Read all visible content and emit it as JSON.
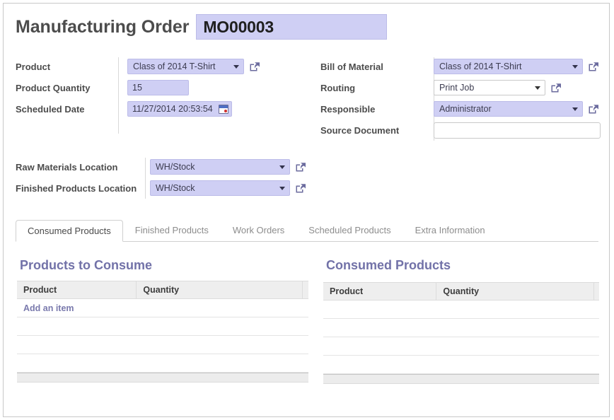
{
  "header": {
    "title": "Manufacturing Order",
    "reference": "MO00003"
  },
  "form": {
    "left_fields": [
      {
        "label": "Product",
        "value": "Class of 2014 T-Shirt",
        "widget": "select",
        "highlight": true,
        "link": true
      },
      {
        "label": "Product Quantity",
        "value": "15",
        "widget": "text",
        "highlight": true,
        "link": false
      },
      {
        "label": "Scheduled Date",
        "value": "11/27/2014 20:53:54",
        "widget": "datetime",
        "highlight": true,
        "link": false
      }
    ],
    "right_fields": [
      {
        "label": "Bill of Material",
        "value": "Class of 2014 T-Shirt",
        "widget": "select",
        "highlight": true,
        "link": true
      },
      {
        "label": "Routing",
        "value": "Print Job",
        "widget": "select",
        "highlight": false,
        "link": true
      },
      {
        "label": "Responsible",
        "value": "Administrator",
        "widget": "select",
        "highlight": true,
        "link": true
      },
      {
        "label": "Source Document",
        "value": "",
        "widget": "text",
        "highlight": false,
        "link": false
      }
    ],
    "location_fields": [
      {
        "label": "Raw Materials Location",
        "value": "WH/Stock",
        "widget": "select",
        "highlight": true,
        "link": true
      },
      {
        "label": "Finished Products Location",
        "value": "WH/Stock",
        "widget": "select",
        "highlight": true,
        "link": true
      }
    ]
  },
  "tabs": [
    {
      "label": "Consumed Products",
      "active": true
    },
    {
      "label": "Finished Products",
      "active": false
    },
    {
      "label": "Work Orders",
      "active": false
    },
    {
      "label": "Scheduled Products",
      "active": false
    },
    {
      "label": "Extra Information",
      "active": false
    }
  ],
  "tables": {
    "left": {
      "title": "Products to Consume",
      "columns": [
        "Product",
        "Quantity"
      ],
      "rows": [],
      "add_label": "Add an item",
      "has_add_row": true,
      "blank_rows": 3
    },
    "right": {
      "title": "Consumed Products",
      "columns": [
        "Product",
        "Quantity"
      ],
      "rows": [],
      "add_label": "",
      "has_add_row": false,
      "blank_rows": 4
    }
  },
  "icons": {
    "external_link": "external-link-icon",
    "calendar": "calendar-icon",
    "dropdown_caret": "chevron-down-icon"
  },
  "colors": {
    "field_highlight": "#cfcff4",
    "field_border": "#bcbce8",
    "section_title": "#7272a8",
    "link": "#7a7aad",
    "label": "#4c4c4c",
    "table_header": "#eeeeee"
  }
}
